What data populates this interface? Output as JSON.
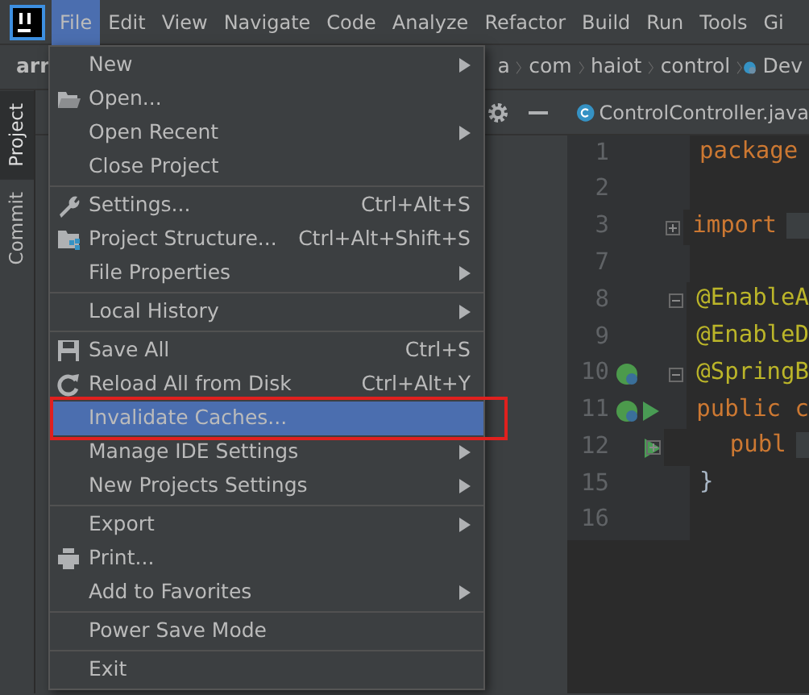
{
  "menubar": [
    {
      "label": "File",
      "selected": true
    },
    {
      "label": "Edit",
      "selected": false
    },
    {
      "label": "View",
      "selected": false
    },
    {
      "label": "Navigate",
      "selected": false
    },
    {
      "label": "Code",
      "selected": false
    },
    {
      "label": "Analyze",
      "selected": false
    },
    {
      "label": "Refactor",
      "selected": false
    },
    {
      "label": "Build",
      "selected": false
    },
    {
      "label": "Run",
      "selected": false
    },
    {
      "label": "Tools",
      "selected": false
    },
    {
      "label": "Gi",
      "selected": false
    }
  ],
  "breadcrumbs": [
    "arr",
    "a",
    "com",
    "haiot",
    "control",
    "Dev"
  ],
  "side_tabs": [
    {
      "label": "Project",
      "selected": true
    },
    {
      "label": "Commit",
      "selected": false
    }
  ],
  "editor_tab": {
    "label": "ControlController.java"
  },
  "editor_lines": [
    {
      "number": "1",
      "code": "package",
      "kind": "keyword"
    },
    {
      "number": "2",
      "kind": "plain"
    },
    {
      "number": "3",
      "code": "import",
      "kind": "keyword",
      "folded": true
    },
    {
      "number": "7",
      "kind": "plain"
    },
    {
      "number": "8",
      "code": "@EnableA",
      "kind": "annotation",
      "folded": false
    },
    {
      "number": "9",
      "code": "@EnableD",
      "kind": "annotation"
    },
    {
      "number": "10",
      "code": "@SpringB",
      "kind": "annotation",
      "folded": false,
      "bean": true
    },
    {
      "number": "11",
      "code": "public c",
      "kind": "keyword",
      "bean": true,
      "runnable": true
    },
    {
      "number": "12",
      "code": "    publ",
      "kind": "keyword",
      "folded": true,
      "runnable": true
    },
    {
      "number": "15",
      "code": "}",
      "kind": "plain"
    },
    {
      "number": "16",
      "kind": "plain"
    }
  ],
  "file_menu": [
    {
      "kind": "item",
      "label": "New",
      "submenu": true,
      "selected": false
    },
    {
      "kind": "item",
      "label": "Open...",
      "selected": false
    },
    {
      "kind": "item",
      "label": "Open Recent",
      "submenu": true,
      "selected": false
    },
    {
      "kind": "item",
      "label": "Close Project",
      "selected": false
    },
    {
      "kind": "separator"
    },
    {
      "kind": "item",
      "label": "Settings...",
      "shortcut": "Ctrl+Alt+S",
      "selected": false
    },
    {
      "kind": "item",
      "label": "Project Structure...",
      "shortcut": "Ctrl+Alt+Shift+S",
      "selected": false
    },
    {
      "kind": "item",
      "label": "File Properties",
      "submenu": true,
      "selected": false
    },
    {
      "kind": "separator"
    },
    {
      "kind": "item",
      "label": "Local History",
      "submenu": true,
      "selected": false
    },
    {
      "kind": "separator"
    },
    {
      "kind": "item",
      "label": "Save All",
      "shortcut": "Ctrl+S",
      "selected": false
    },
    {
      "kind": "item",
      "label": "Reload All from Disk",
      "shortcut": "Ctrl+Alt+Y",
      "selected": false
    },
    {
      "kind": "item",
      "label": "Invalidate Caches...",
      "selected": true,
      "highlighted": true
    },
    {
      "kind": "item",
      "label": "Manage IDE Settings",
      "submenu": true,
      "selected": false
    },
    {
      "kind": "item",
      "label": "New Projects Settings",
      "submenu": true,
      "selected": false
    },
    {
      "kind": "separator"
    },
    {
      "kind": "item",
      "label": "Export",
      "submenu": true,
      "selected": false
    },
    {
      "kind": "item",
      "label": "Print...",
      "selected": false
    },
    {
      "kind": "item",
      "label": "Add to Favorites",
      "submenu": true,
      "selected": false
    },
    {
      "kind": "separator"
    },
    {
      "kind": "item",
      "label": "Power Save Mode",
      "selected": false
    },
    {
      "kind": "separator"
    },
    {
      "kind": "item",
      "label": "Exit",
      "selected": false
    }
  ]
}
